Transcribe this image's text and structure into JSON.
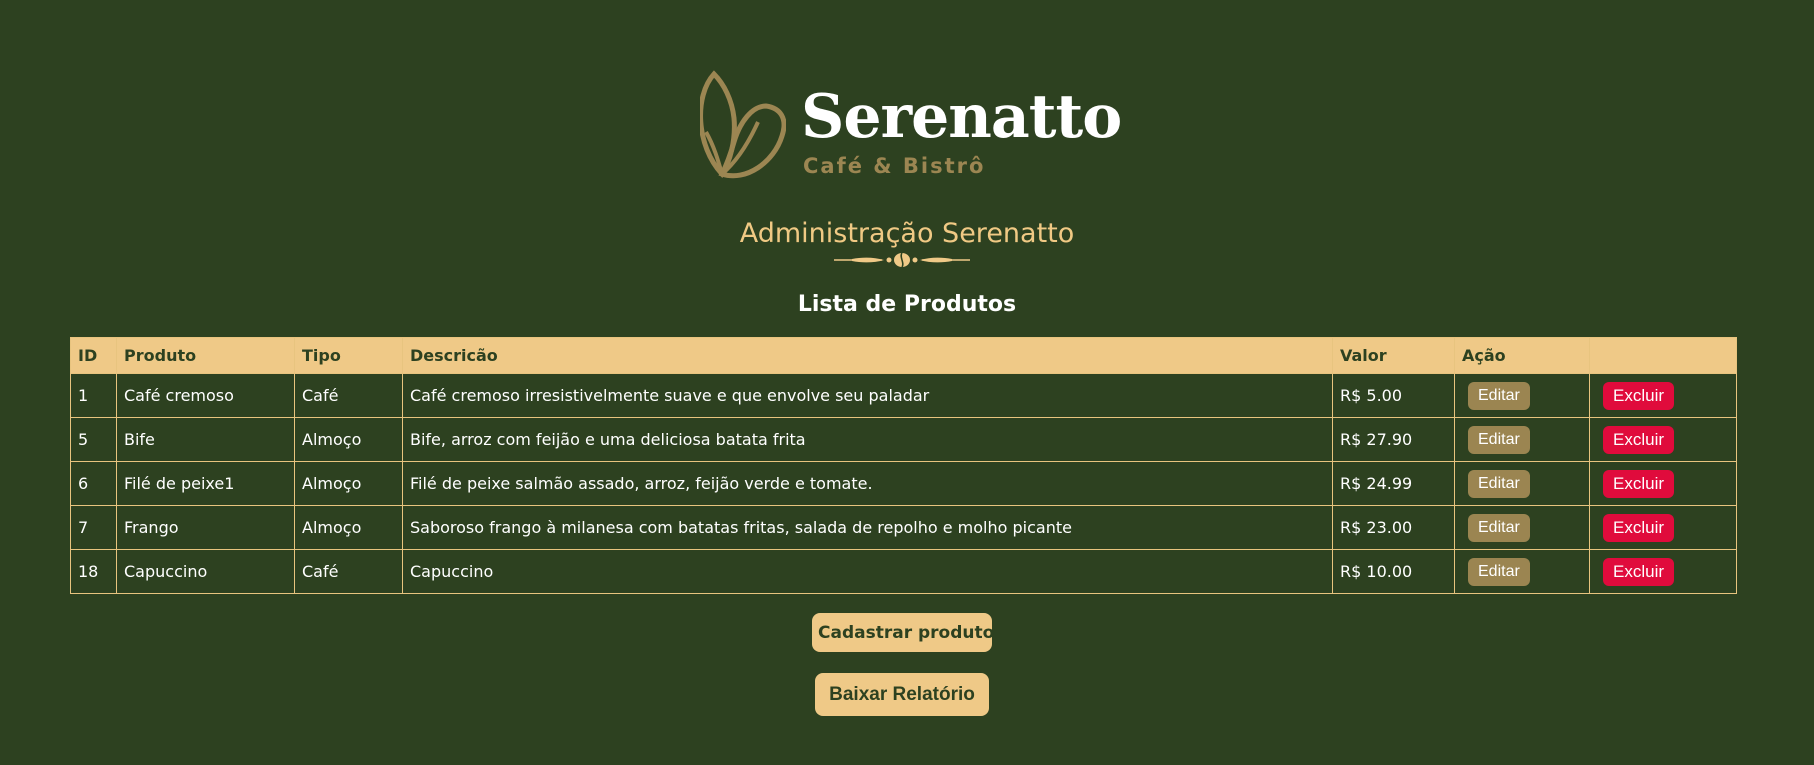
{
  "brand": {
    "name": "Serenatto",
    "subtitle": "Café & Bistrô",
    "gold": "#9c8652"
  },
  "header": {
    "admin_title": "Administração Serenatto",
    "list_title": "Lista de Produtos"
  },
  "table": {
    "columns": [
      "ID",
      "Produto",
      "Tipo",
      "Descricão",
      "Valor",
      "Ação"
    ],
    "rows": [
      {
        "id": "1",
        "produto": "Café cremoso",
        "tipo": "Café",
        "descricao": "Café cremoso irresistivelmente suave e que envolve seu paladar",
        "valor": "R$ 5.00"
      },
      {
        "id": "5",
        "produto": "Bife",
        "tipo": "Almoço",
        "descricao": "Bife, arroz com feijão e uma deliciosa batata frita",
        "valor": "R$ 27.90"
      },
      {
        "id": "6",
        "produto": "Filé de peixe1",
        "tipo": "Almoço",
        "descricao": "Filé de peixe salmão assado, arroz, feijão verde e tomate.",
        "valor": "R$ 24.99"
      },
      {
        "id": "7",
        "produto": "Frango",
        "tipo": "Almoço",
        "descricao": "Saboroso frango à milanesa com batatas fritas, salada de repolho e molho picante",
        "valor": "R$ 23.00"
      },
      {
        "id": "18",
        "produto": "Capuccino",
        "tipo": "Café",
        "descricao": "Capuccino",
        "valor": "R$ 10.00"
      }
    ],
    "edit_label": "Editar",
    "delete_label": "Excluir"
  },
  "actions": {
    "register_label": "Cadastrar produto",
    "report_label": "Baixar Relatório"
  },
  "colors": {
    "background": "#2d4120",
    "accent": "#efc987",
    "delete": "#e00b3c",
    "edit": "#9b8551"
  }
}
